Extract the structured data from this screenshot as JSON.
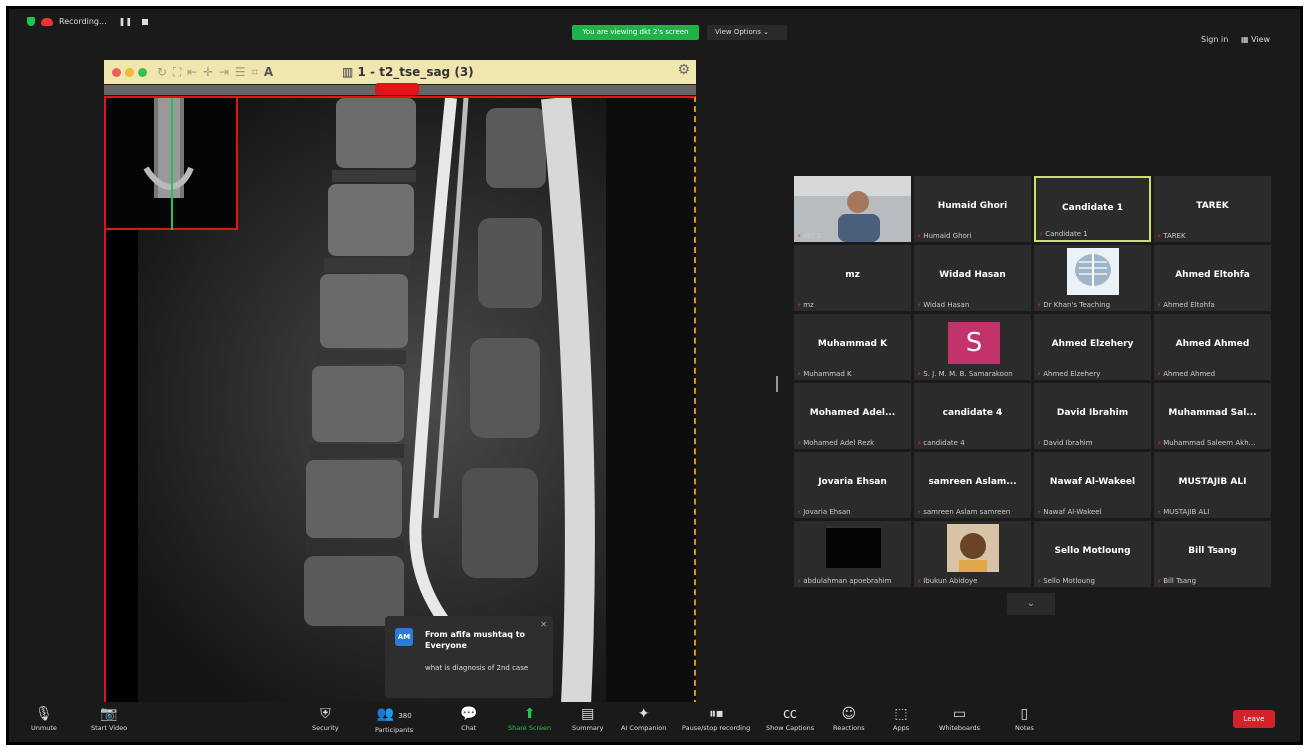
{
  "topbar": {
    "recording_label": "Recording...",
    "viewing_banner": "You are viewing dkt 2's screen",
    "view_options": "View Options",
    "sign_in": "Sign in",
    "view": "View"
  },
  "viewer": {
    "series_title": "1 - t2_tse_sag (3)"
  },
  "gallery": {
    "tiles": [
      {
        "name": "",
        "label": "dkt 2",
        "type": "video"
      },
      {
        "name": "Humaid Ghori",
        "label": "Humaid Ghori"
      },
      {
        "name": "Candidate 1",
        "label": "Candidate 1",
        "active": true
      },
      {
        "name": "TAREK",
        "label": "TAREK"
      },
      {
        "name": "mz",
        "label": "mz"
      },
      {
        "name": "Widad Hasan",
        "label": "Widad Hasan"
      },
      {
        "name": "",
        "label": "Dr Khan's Teaching",
        "type": "xray"
      },
      {
        "name": "Ahmed Eltohfa",
        "label": "Ahmed Eltohfa"
      },
      {
        "name": "Muhammad K",
        "label": "Muhammad K"
      },
      {
        "name": "S",
        "label": "S. J. M. M. B. Samarakoon",
        "type": "avatar"
      },
      {
        "name": "Ahmed Elzehery",
        "label": "Ahmed Elzehery"
      },
      {
        "name": "Ahmed Ahmed",
        "label": "Ahmed Ahmed"
      },
      {
        "name": "Mohamed Adel...",
        "label": "Mohamed Adel Rezk"
      },
      {
        "name": "candidate 4",
        "label": "candidate 4"
      },
      {
        "name": "David Ibrahim",
        "label": "David Ibrahim"
      },
      {
        "name": "Muhammad Sal...",
        "label": "Muhammad Saleem Akh..."
      },
      {
        "name": "Jovaria Ehsan",
        "label": "Jovaria Ehsan"
      },
      {
        "name": "samreen Aslam...",
        "label": "samreen Aslam samreen"
      },
      {
        "name": "Nawaf Al-Wakeel",
        "label": "Nawaf Al-Wakeel"
      },
      {
        "name": "MUSTAJIB ALI",
        "label": "MUSTAJIB ALI"
      },
      {
        "name": "",
        "label": "abdulahman apoebrahim",
        "type": "dark"
      },
      {
        "name": "",
        "label": "Ibukun Abidoye",
        "type": "child"
      },
      {
        "name": "Sello Motloung",
        "label": "Sello Motloung"
      },
      {
        "name": "Bill Tsang",
        "label": "Bill Tsang"
      }
    ]
  },
  "chat": {
    "initials": "AM",
    "from": "From afifa mushtaq to Everyone",
    "message": "what is diagnosis of 2nd case"
  },
  "toolbar": {
    "unmute": "Unmute",
    "start_video": "Start Video",
    "security": "Security",
    "participants": "Participants",
    "participants_count": "380",
    "chat": "Chat",
    "share_screen": "Share Screen",
    "summary": "Summary",
    "ai_companion": "AI Companion",
    "pause_stop_recording": "Pause/stop recording",
    "show_captions": "Show Captions",
    "reactions": "Reactions",
    "apps": "Apps",
    "whiteboards": "Whiteboards",
    "notes": "Notes",
    "leave": "Leave"
  },
  "colors": {
    "accent_green": "#23c552",
    "leave_red": "#d3232a",
    "active_tile": "#c9e06a"
  }
}
